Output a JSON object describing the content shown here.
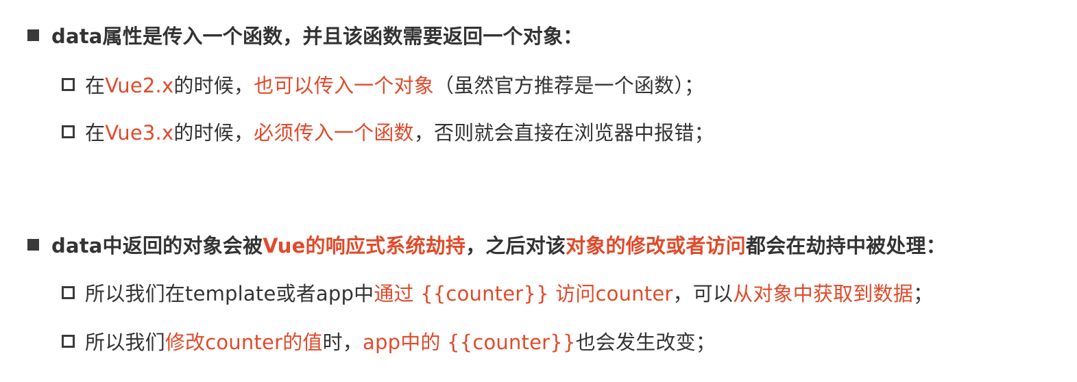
{
  "colors": {
    "text": "#333333",
    "highlight": "#e04a2a",
    "bullet": "#3a3a3a"
  },
  "section1": {
    "heading": "data属性是传入一个函数，并且该函数需要返回一个对象：",
    "items": [
      {
        "parts": [
          "在",
          "Vue2.x",
          "的时候，",
          "也可以传入一个对象",
          "（虽然官方推荐是一个函数）；"
        ]
      },
      {
        "parts": [
          "在",
          "Vue3.x",
          "的时候，",
          "必须传入一个函数",
          "，否则就会直接在浏览器中报错；"
        ]
      }
    ]
  },
  "section2": {
    "heading_parts": [
      "data中返回的对象会被",
      "Vue的响应式系统劫持",
      "，之后对该",
      "对象的修改或者访问",
      "都会在劫持中被处理："
    ],
    "items": [
      {
        "parts": [
          "所以我们在template或者app中",
          "通过 {{counter}} 访问counter",
          "，可以",
          "从对象中获取到数据",
          "；"
        ]
      },
      {
        "parts": [
          "所以我们",
          "修改counter的值",
          "时，",
          "app中的 {{counter}}",
          "也会发生改变；"
        ]
      }
    ]
  }
}
